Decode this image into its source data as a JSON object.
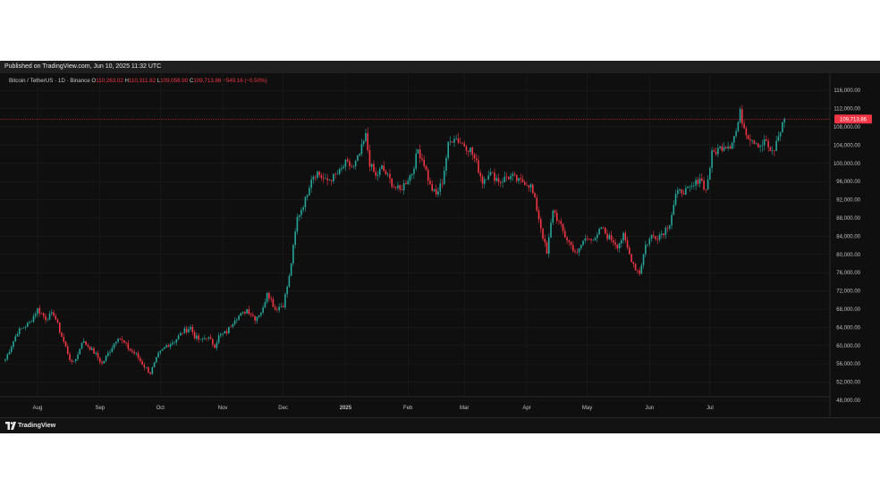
{
  "header": {
    "published": "Published on TradingView.com, Jun 10, 2025 11:32 UTC"
  },
  "legend": {
    "symbol": "Bitcoin / TetherUS · 1D · Binance",
    "open_key": "O",
    "open": "110,263.02",
    "high_key": "H",
    "high": "110,311.82",
    "low_key": "L",
    "low": "109,056.90",
    "close_key": "C",
    "close": "109,713.86",
    "change": "−549.16 (−0.50%)"
  },
  "footer": {
    "brand": "TradingView"
  },
  "colors": {
    "up": "#26a69a",
    "down": "#f23645",
    "background": "#0f0f0f",
    "grid": "#1e1e1e",
    "price_line": "#f23645"
  },
  "chart_data": {
    "type": "candlestick",
    "symbol": "BTCUSDT",
    "interval": "1D",
    "exchange": "Binance",
    "x_ticks": [
      "Aug",
      "Sep",
      "Oct",
      "Nov",
      "Dec",
      "2025",
      "Feb",
      "Mar",
      "Apr",
      "May",
      "Jun",
      "Jul"
    ],
    "y_ticks": [
      "116,000.00",
      "112,000.00",
      "108,000.00",
      "104,000.00",
      "100,000.00",
      "96,000.00",
      "92,000.00",
      "88,000.00",
      "84,000.00",
      "80,000.00",
      "76,000.00",
      "72,000.00",
      "68,000.00",
      "64,000.00",
      "60,000.00",
      "56,000.00",
      "52,000.00",
      "48,000.00"
    ],
    "ylim": [
      46000,
      117500
    ],
    "last_price": 109713.86,
    "last_price_label": "109,713.86",
    "grid": true,
    "anchors": [
      [
        0,
        57000
      ],
      [
        6,
        63000
      ],
      [
        12,
        65000
      ],
      [
        16,
        68000
      ],
      [
        20,
        66000
      ],
      [
        24,
        67000
      ],
      [
        28,
        62000
      ],
      [
        33,
        56000
      ],
      [
        36,
        58000
      ],
      [
        38,
        61000
      ],
      [
        41,
        60000
      ],
      [
        45,
        58000
      ],
      [
        48,
        56000
      ],
      [
        52,
        59000
      ],
      [
        56,
        62000
      ],
      [
        58,
        61000
      ],
      [
        62,
        59000
      ],
      [
        65,
        58000
      ],
      [
        68,
        56000
      ],
      [
        72,
        54000
      ],
      [
        76,
        58000
      ],
      [
        80,
        60000
      ],
      [
        84,
        61000
      ],
      [
        88,
        63000
      ],
      [
        92,
        64000
      ],
      [
        94,
        62000
      ],
      [
        97,
        61000
      ],
      [
        100,
        62000
      ],
      [
        104,
        60000
      ],
      [
        106,
        62000
      ],
      [
        110,
        63000
      ],
      [
        114,
        66000
      ],
      [
        118,
        67000
      ],
      [
        120,
        68000
      ],
      [
        124,
        66000
      ],
      [
        128,
        68000
      ],
      [
        130,
        72000
      ],
      [
        132,
        70000
      ],
      [
        134,
        68000
      ],
      [
        138,
        69000
      ],
      [
        141,
        75000
      ],
      [
        145,
        88000
      ],
      [
        149,
        92000
      ],
      [
        152,
        97000
      ],
      [
        155,
        98000
      ],
      [
        159,
        96000
      ],
      [
        163,
        97000
      ],
      [
        166,
        98000
      ],
      [
        169,
        100000
      ],
      [
        173,
        99000
      ],
      [
        176,
        102000
      ],
      [
        179,
        106000
      ],
      [
        181,
        100000
      ],
      [
        184,
        97000
      ],
      [
        187,
        99000
      ],
      [
        190,
        97000
      ],
      [
        193,
        95000
      ],
      [
        196,
        94000
      ],
      [
        199,
        96000
      ],
      [
        202,
        98000
      ],
      [
        205,
        103000
      ],
      [
        208,
        100000
      ],
      [
        211,
        95000
      ],
      [
        214,
        93000
      ],
      [
        217,
        96000
      ],
      [
        220,
        104000
      ],
      [
        223,
        106000
      ],
      [
        225,
        105000
      ],
      [
        228,
        104000
      ],
      [
        231,
        103000
      ],
      [
        234,
        100000
      ],
      [
        237,
        96000
      ],
      [
        240,
        98000
      ],
      [
        243,
        97000
      ],
      [
        246,
        96000
      ],
      [
        249,
        97000
      ],
      [
        252,
        97000
      ],
      [
        255,
        96000
      ],
      [
        258,
        96000
      ],
      [
        261,
        95000
      ],
      [
        264,
        90000
      ],
      [
        266,
        86000
      ],
      [
        269,
        80000
      ],
      [
        272,
        90000
      ],
      [
        275,
        87000
      ],
      [
        278,
        84000
      ],
      [
        281,
        82000
      ],
      [
        284,
        80000
      ],
      [
        287,
        83000
      ],
      [
        290,
        84000
      ],
      [
        293,
        83000
      ],
      [
        296,
        86000
      ],
      [
        299,
        84000
      ],
      [
        302,
        83000
      ],
      [
        304,
        82000
      ],
      [
        307,
        84000
      ],
      [
        310,
        80000
      ],
      [
        313,
        77000
      ],
      [
        315,
        76000
      ],
      [
        318,
        82000
      ],
      [
        321,
        84000
      ],
      [
        324,
        84000
      ],
      [
        327,
        85000
      ],
      [
        330,
        87000
      ],
      [
        333,
        93000
      ],
      [
        336,
        94000
      ],
      [
        339,
        94000
      ],
      [
        342,
        95000
      ],
      [
        345,
        97000
      ],
      [
        348,
        94000
      ],
      [
        351,
        102000
      ],
      [
        354,
        103000
      ],
      [
        357,
        104000
      ],
      [
        360,
        104000
      ],
      [
        363,
        107000
      ],
      [
        365,
        111000
      ],
      [
        367,
        108000
      ],
      [
        369,
        106000
      ],
      [
        372,
        105000
      ],
      [
        375,
        104000
      ],
      [
        378,
        105000
      ],
      [
        380,
        102000
      ],
      [
        382,
        103000
      ],
      [
        384,
        106000
      ],
      [
        387,
        109714
      ]
    ]
  }
}
